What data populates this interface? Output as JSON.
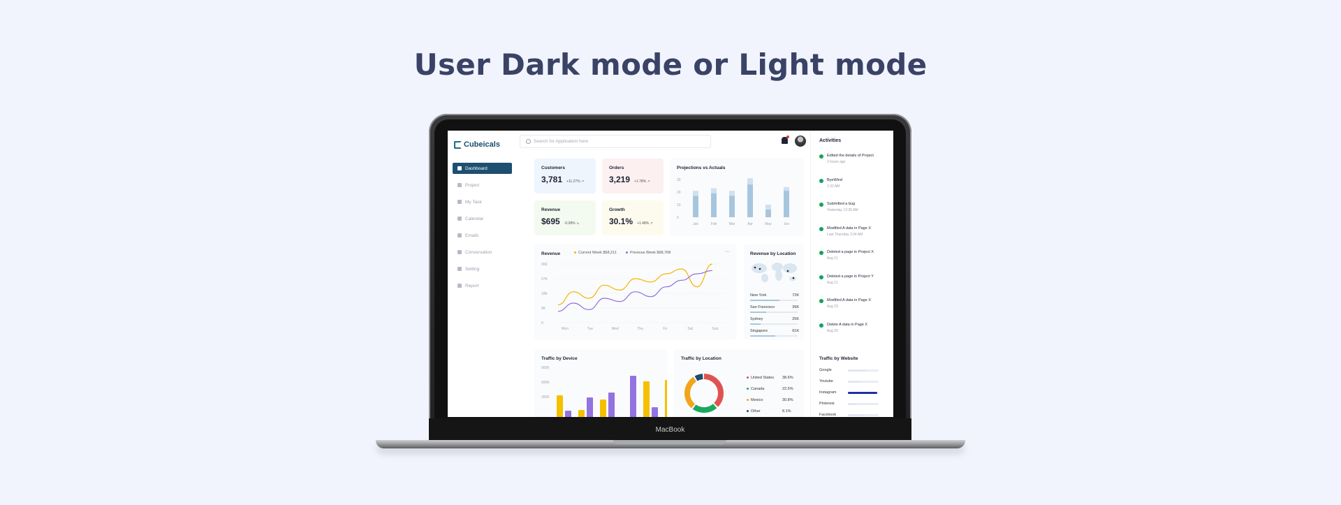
{
  "headline": "User Dark mode or Light mode",
  "device_label": "MacBook",
  "app": {
    "brand": "Cubeicals",
    "search_placeholder": "Search for Application here",
    "nav": [
      {
        "label": "Dashboard",
        "active": true
      },
      {
        "label": "Project"
      },
      {
        "label": "My Task"
      },
      {
        "label": "Calendar"
      },
      {
        "label": "Emails"
      },
      {
        "label": "Conversation"
      },
      {
        "label": "Setting"
      },
      {
        "label": "Report"
      }
    ],
    "stats": [
      {
        "label": "Customers",
        "value": "3,781",
        "change": "+11.27% ↗",
        "bg": "#eef5fd"
      },
      {
        "label": "Orders",
        "value": "3,219",
        "change": "+1.78% ↗",
        "bg": "#fdf0f0"
      },
      {
        "label": "Revenue",
        "value": "$695",
        "change": "-0.08% ↘",
        "bg": "#f3faef"
      },
      {
        "label": "Growth",
        "value": "30.1%",
        "change": "+1.48% ↗",
        "bg": "#fcfbee"
      }
    ],
    "projections": {
      "title": "Projections vs Actuals",
      "y_ticks": [
        "30",
        "20",
        "10",
        "0"
      ]
    },
    "revenue": {
      "title": "Revenue",
      "legend_current": "Current Week $58,211",
      "legend_previous": "Previous Week $68,768",
      "menu": "···",
      "y_ticks": [
        "36K",
        "27K",
        "18K",
        "9K",
        "0"
      ]
    },
    "location": {
      "title": "Revenue by Location",
      "rows": [
        {
          "city": "New York",
          "value": "72K",
          "fill": 0.72
        },
        {
          "city": "San Francisco",
          "value": "39K",
          "fill": 0.39
        },
        {
          "city": "Sydney",
          "value": "25K",
          "fill": 0.25
        },
        {
          "city": "Singapore",
          "value": "61K",
          "fill": 0.61
        }
      ]
    },
    "device": {
      "title": "Traffic by Device",
      "y_ticks": [
        "900K",
        "600K",
        "300K"
      ]
    },
    "traffic_location": {
      "title": "Traffic by Location",
      "rows": [
        {
          "name": "United States",
          "value": "38.6%",
          "color": "#e05252"
        },
        {
          "name": "Canada",
          "value": "22.5%",
          "color": "#1aa85f"
        },
        {
          "name": "Mexico",
          "value": "30.8%",
          "color": "#f0a51a"
        },
        {
          "name": "Other",
          "value": "8.1%",
          "color": "#1b4c6e"
        }
      ]
    },
    "activities": {
      "title": "Activities",
      "items": [
        {
          "text": "Edited the details of Project",
          "date": "2 hours ago"
        },
        {
          "text": "ByeWind",
          "date": "1:32 AM"
        },
        {
          "text": "Submitted a bug",
          "date": "Yesterday 12:39 AM"
        },
        {
          "text": "Modified A data in Page X",
          "date": "Last Thursday 3:34 AM"
        },
        {
          "text": "Deleted a page in Project X",
          "date": "Aug 11"
        },
        {
          "text": "Deleted a page in Project Y",
          "date": "Aug 11"
        },
        {
          "text": "Modified A data in Page X",
          "date": "Aug 23"
        },
        {
          "text": "Delete A data in Page X",
          "date": "Aug 20"
        }
      ]
    },
    "websites": {
      "title": "Traffic by Website",
      "rows": [
        {
          "name": "Google",
          "fill": 0.6
        },
        {
          "name": "Youtube",
          "fill": 0.4
        },
        {
          "name": "Instagram",
          "fill": 0.95,
          "highlight": true
        },
        {
          "name": "Pinterest",
          "fill": 0.3
        },
        {
          "name": "Facebook",
          "fill": 0.5
        }
      ]
    },
    "colors": {
      "accent": "#1d4f71",
      "current_line": "#f5b400",
      "previous_line": "#8e6fe0",
      "proj_actual": "#a7c6de",
      "proj_projected": "#cfe0ef"
    }
  },
  "chart_data": [
    {
      "type": "bar",
      "title": "Projections vs Actuals",
      "categories": [
        "Jan",
        "Feb",
        "Mar",
        "Apr",
        "May",
        "Jun"
      ],
      "series": [
        {
          "values": [
            17,
            19,
            17,
            26,
            6,
            21
          ]
        },
        {
          "values": [
            21,
            23,
            21,
            31,
            10,
            24
          ]
        }
      ],
      "ylim": [
        0,
        30
      ]
    },
    {
      "type": "line",
      "title": "Revenue",
      "x": [
        "Mon",
        "Tue",
        "Wed",
        "Thu",
        "Fri",
        "Sat",
        "Sun"
      ],
      "series": [
        {
          "name": "Current Week $58,211",
          "values": [
            11,
            19,
            15,
            23,
            20,
            27,
            25,
            30,
            33,
            22,
            36
          ]
        },
        {
          "name": "Previous Week $68,768",
          "values": [
            7,
            12,
            8,
            15,
            13,
            19,
            16,
            22,
            26,
            30,
            32
          ]
        }
      ],
      "ylim": [
        0,
        36
      ]
    },
    {
      "type": "bar",
      "title": "Traffic by Device",
      "y_ticks": [
        "900K",
        "600K",
        "300K"
      ],
      "series": [
        {
          "values": [
            520,
            310,
            460,
            210,
            720,
            740
          ]
        },
        {
          "values": [
            300,
            490,
            560,
            800,
            350,
            430
          ]
        }
      ],
      "ylim": [
        0,
        900
      ]
    },
    {
      "type": "pie",
      "title": "Traffic by Location",
      "categories": [
        "United States",
        "Canada",
        "Mexico",
        "Other"
      ],
      "values": [
        38.6,
        22.5,
        30.8,
        8.1
      ]
    }
  ]
}
